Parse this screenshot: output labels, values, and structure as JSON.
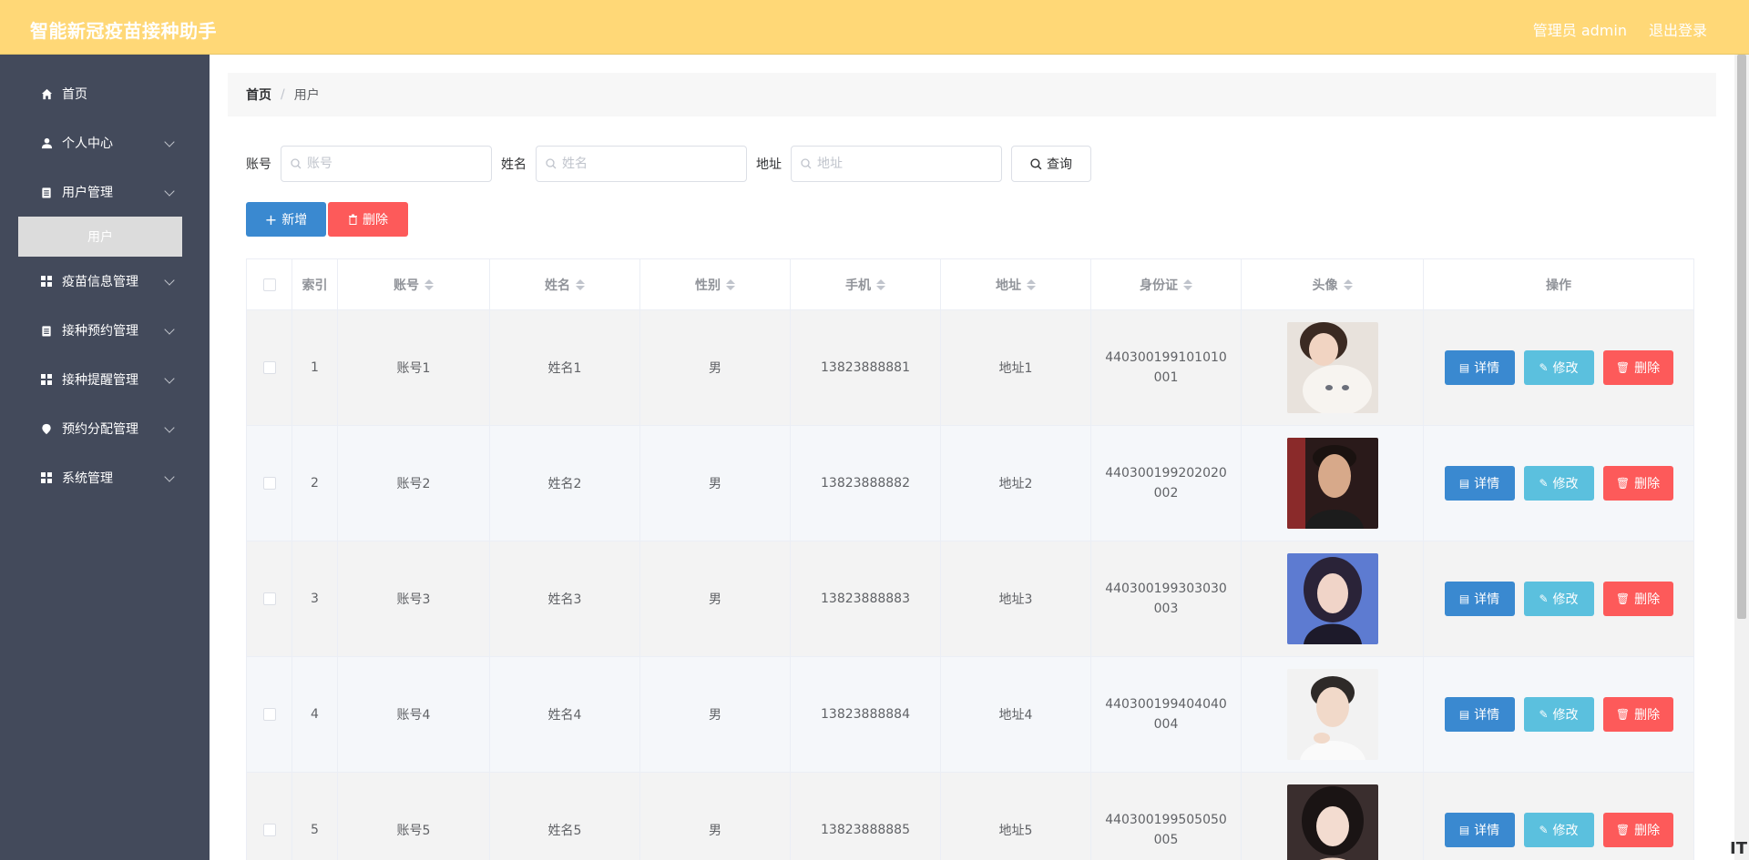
{
  "header": {
    "title": "智能新冠疫苗接种助手",
    "user_label": "管理员 admin",
    "logout_label": "退出登录"
  },
  "sidebar": {
    "items": [
      {
        "label": "首页",
        "icon": "home-icon"
      },
      {
        "label": "个人中心",
        "icon": "user-icon"
      },
      {
        "label": "用户管理",
        "icon": "clipboard-icon"
      },
      {
        "label": "疫苗信息管理",
        "icon": "grid-icon"
      },
      {
        "label": "接种预约管理",
        "icon": "clipboard-icon"
      },
      {
        "label": "接种提醒管理",
        "icon": "grid-icon"
      },
      {
        "label": "预约分配管理",
        "icon": "pin-icon"
      },
      {
        "label": "系统管理",
        "icon": "grid-icon"
      }
    ],
    "active_sub": "用户"
  },
  "breadcrumb": {
    "home": "首页",
    "sep": "/",
    "current": "用户"
  },
  "search": {
    "account_label": "账号",
    "account_placeholder": "账号",
    "name_label": "姓名",
    "name_placeholder": "姓名",
    "address_label": "地址",
    "address_placeholder": "地址",
    "query_label": "查询"
  },
  "actions": {
    "add_label": "新增",
    "delete_label": "删除"
  },
  "table": {
    "headers": {
      "index": "索引",
      "account": "账号",
      "name": "姓名",
      "sex": "性别",
      "phone": "手机",
      "address": "地址",
      "idcard": "身份证",
      "avatar": "头像",
      "op": "操作"
    },
    "op_labels": {
      "detail": "详情",
      "edit": "修改",
      "delete": "删除"
    },
    "rows": [
      {
        "index": "1",
        "account": "账号1",
        "name": "姓名1",
        "sex": "男",
        "phone": "13823888881",
        "address": "地址1",
        "idcard": "440300199101010001"
      },
      {
        "index": "2",
        "account": "账号2",
        "name": "姓名2",
        "sex": "男",
        "phone": "13823888882",
        "address": "地址2",
        "idcard": "440300199202020002"
      },
      {
        "index": "3",
        "account": "账号3",
        "name": "姓名3",
        "sex": "男",
        "phone": "13823888883",
        "address": "地址3",
        "idcard": "440300199303030003"
      },
      {
        "index": "4",
        "account": "账号4",
        "name": "姓名4",
        "sex": "男",
        "phone": "13823888884",
        "address": "地址4",
        "idcard": "440300199404040004"
      },
      {
        "index": "5",
        "account": "账号5",
        "name": "姓名5",
        "sex": "男",
        "phone": "13823888885",
        "address": "地址5",
        "idcard": "440300199505050005"
      }
    ]
  },
  "footer": {
    "mark": "IT"
  }
}
